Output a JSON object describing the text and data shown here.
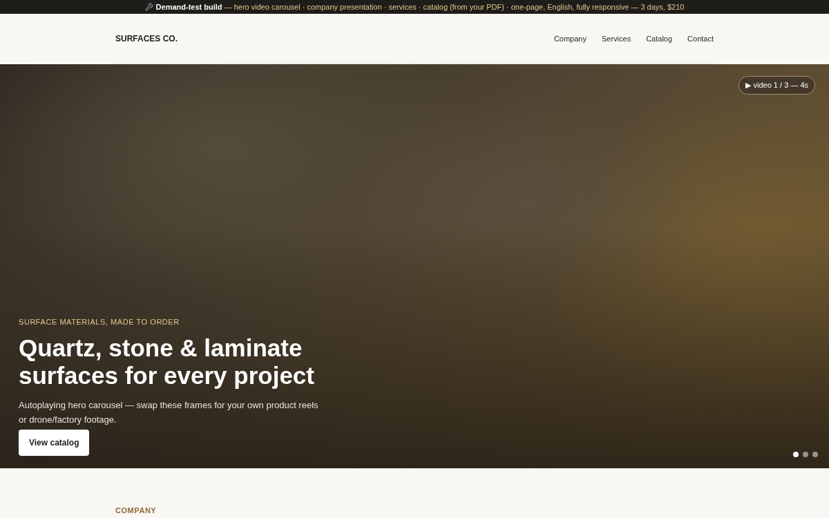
{
  "announcement": "**Demand-test build** — hero video carousel · company presentation · services · catalog (from your PDF) · one-page, English, fully responsive — 3 days, $210",
  "header": {
    "logo": "SURFACES CO.",
    "nav": [
      {
        "label": "Company"
      },
      {
        "label": "Services"
      },
      {
        "label": "Catalog"
      },
      {
        "label": "Contact"
      }
    ]
  },
  "hero": {
    "video_badge": "▶ video 1 / 3 — 4s",
    "eyebrow": "SURFACE MATERIALS, MADE TO ORDER",
    "title": "Quartz, stone & laminate surfaces for every project",
    "description": "Autoplaying hero carousel — swap these frames for your own product reels or drone/factory footage.",
    "button": "View catalog",
    "dots": [
      {
        "selected": true
      },
      {
        "selected": false
      },
      {
        "selected": false
      }
    ]
  },
  "section": {
    "eyebrow": "COMPANY"
  }
}
